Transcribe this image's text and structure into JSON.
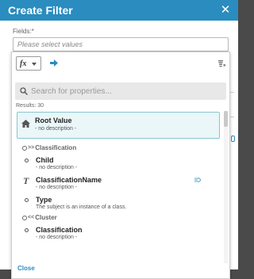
{
  "dialog": {
    "title": "Create Filter",
    "fields_label": "Fields:*",
    "fields_placeholder": "Please select values"
  },
  "toolbar": {
    "function_label": "fx"
  },
  "search": {
    "placeholder": "Search for properties...",
    "results": "Results: 30"
  },
  "list": {
    "root": {
      "name": "Root Value",
      "description": "- no description -"
    },
    "groups": [
      {
        "label": "Classification",
        "arrows": ">>",
        "items": [
          {
            "name": "Child",
            "description": "- no description -",
            "icon": "dot-icon"
          },
          {
            "name": "ClassificationName",
            "description": "- no description -",
            "icon": "text-type-icon"
          },
          {
            "name": "Type",
            "description": "The subject is an instance of a class.",
            "icon": "dot-icon"
          }
        ]
      },
      {
        "label": "Cluster",
        "arrows": "<<",
        "items": [
          {
            "name": "Classification",
            "description": "- no description -",
            "icon": "dot-icon"
          }
        ]
      }
    ]
  },
  "footer": {
    "close_label": "Close"
  },
  "colors": {
    "header": "#2a8cbf",
    "selected_bg": "#eaf6f7",
    "selected_border": "#88c7cf",
    "link": "#2a8cbf"
  }
}
